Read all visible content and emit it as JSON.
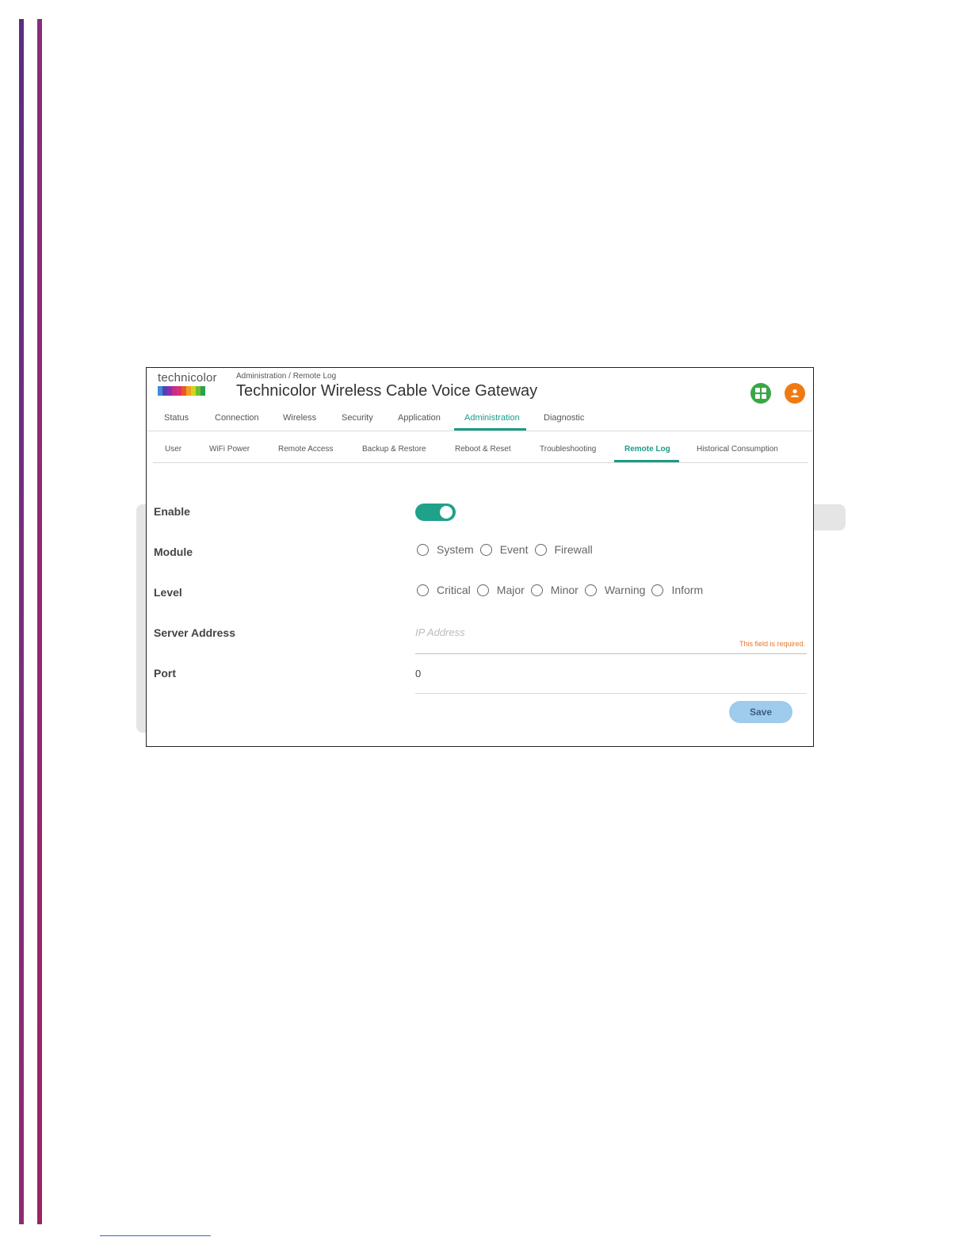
{
  "header": {
    "logo_text": "technicolor",
    "breadcrumb": "Administration / Remote Log",
    "title": "Technicolor Wireless Cable Voice Gateway",
    "icons": [
      "apps-grid-icon",
      "user-icon"
    ]
  },
  "main_nav": {
    "tabs": [
      {
        "label": "Status"
      },
      {
        "label": "Connection"
      },
      {
        "label": "Wireless"
      },
      {
        "label": "Security"
      },
      {
        "label": "Application"
      },
      {
        "label": "Administration",
        "active": true
      },
      {
        "label": "Diagnostic"
      }
    ]
  },
  "sub_nav": {
    "tabs": [
      {
        "label": "User"
      },
      {
        "label": "WiFi Power"
      },
      {
        "label": "Remote Access"
      },
      {
        "label": "Backup & Restore"
      },
      {
        "label": "Reboot & Reset"
      },
      {
        "label": "Troubleshooting"
      },
      {
        "label": "Remote Log",
        "active": true
      },
      {
        "label": "Historical Consumption"
      }
    ]
  },
  "form": {
    "enable": {
      "label": "Enable",
      "value": true
    },
    "module": {
      "label": "Module",
      "options": [
        "System",
        "Event",
        "Firewall"
      ]
    },
    "level": {
      "label": "Level",
      "options": [
        "Critical",
        "Major",
        "Minor",
        "Warning",
        "Inform"
      ]
    },
    "server_address": {
      "label": "Server Address",
      "placeholder": "IP Address",
      "value": "",
      "error": "This field is required."
    },
    "port": {
      "label": "Port",
      "value": "0"
    },
    "save_label": "Save"
  },
  "colors": {
    "accent": "#1b9b86",
    "toggle_on": "#1fa18a",
    "error": "#e8762b",
    "save_button": "#9fcbec",
    "apps_icon": "#3aa745",
    "user_icon": "#f07a12",
    "logo_strip": [
      "#3b8ed8",
      "#5a3fb0",
      "#8a2fb0",
      "#c42f8a",
      "#e0316a",
      "#e8582a",
      "#f0a020",
      "#d9d020",
      "#6cc030",
      "#2aa050"
    ]
  }
}
